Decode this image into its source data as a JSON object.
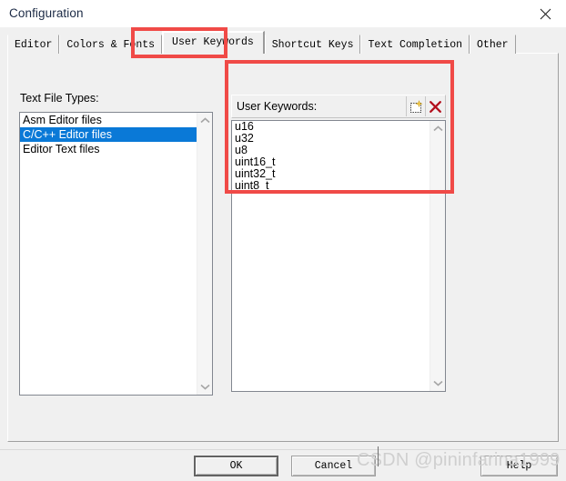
{
  "window": {
    "title": "Configuration",
    "close_icon": "close-icon"
  },
  "tabs": [
    {
      "label": "Editor",
      "active": false
    },
    {
      "label": "Colors & Fonts",
      "active": false
    },
    {
      "label": "User Keywords",
      "active": true
    },
    {
      "label": "Shortcut Keys",
      "active": false
    },
    {
      "label": "Text Completion",
      "active": false
    },
    {
      "label": "Other",
      "active": false
    }
  ],
  "left_panel": {
    "label": "Text File Types:",
    "items": [
      {
        "label": "Asm Editor files",
        "selected": false
      },
      {
        "label": "C/C++ Editor files",
        "selected": true
      },
      {
        "label": "Editor Text files",
        "selected": false
      }
    ]
  },
  "right_panel": {
    "title": "User Keywords:",
    "tools": [
      {
        "name": "new-keyword-icon",
        "tooltip": "New"
      },
      {
        "name": "delete-keyword-icon",
        "tooltip": "Delete"
      }
    ],
    "keywords": [
      "u16",
      "u32",
      "u8",
      "uint16_t",
      "uint32_t",
      "uint8_t"
    ]
  },
  "footer": {
    "ok_label": "OK",
    "cancel_label": "Cancel",
    "help_label": "Help"
  },
  "watermark": "CSDN @pininfarina1999",
  "colors": {
    "selection_blue": "#0a79d7",
    "annotation_red": "#f04a47",
    "dialog_bg": "#f0f0f0",
    "title_text": "#1b2a45"
  }
}
